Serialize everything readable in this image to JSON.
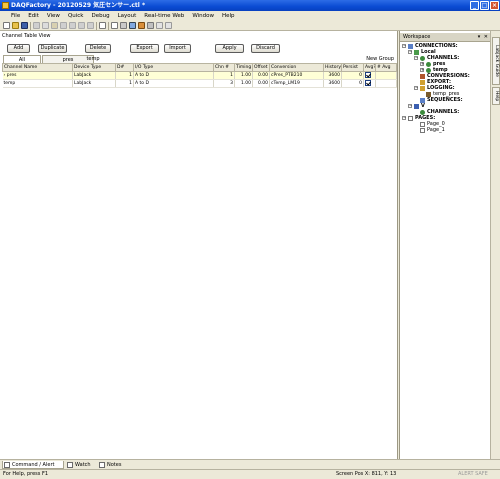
{
  "window": {
    "title": "DAQFactory - 20120529 気圧センサー.ctl *"
  },
  "menu": [
    "File",
    "Edit",
    "View",
    "Quick",
    "Debug",
    "Layout",
    "Real-time Web",
    "Window",
    "Help"
  ],
  "panel": {
    "title": "Channel Table View",
    "buttons": {
      "add": "Add",
      "duplicate": "Duplicate",
      "delete": "Delete",
      "export": "Export",
      "import": "Import",
      "apply": "Apply",
      "discard": "Discard"
    },
    "tabs": {
      "all": "All",
      "pres": "pres",
      "temp": "temp"
    },
    "new_group": "New Group"
  },
  "table": {
    "columns": {
      "name": "Channel Name",
      "device": "Device Type",
      "d_num": "D#",
      "io": "I/O Type",
      "chn": "Chn #",
      "timing": "Timing",
      "offset": "Offset",
      "conversion": "Conversion",
      "history": "History",
      "persist": "Persist",
      "avg": "Avg?",
      "num_avg": "# Avg"
    },
    "rows": [
      {
        "marker": "›",
        "name": "pres",
        "device": "LabJack",
        "d_num": "1",
        "io": "A to D",
        "chn": "1",
        "timing": "1.00",
        "offset": "0.00",
        "conversion": "cPres_PTB210",
        "history": "3600",
        "persist": "0",
        "avg": "",
        "num_avg": ""
      },
      {
        "marker": "",
        "name": "temp",
        "device": "LabJack",
        "d_num": "1",
        "io": "A to D",
        "chn": "3",
        "timing": "1.00",
        "offset": "0.00",
        "conversion": "cTemp_LM19",
        "history": "3600",
        "persist": "0",
        "avg": "",
        "num_avg": ""
      }
    ]
  },
  "workspace": {
    "title": "Workspace",
    "title_buttons": "▾ ✕",
    "tree": {
      "connections": "CONNECTIONS:",
      "local": "Local",
      "channels": "CHANNELS:",
      "pres": "pres",
      "temp": "temp",
      "conversions": "CONVERSIONS:",
      "export": "EXPORT:",
      "logging": "LOGGING:",
      "temp_pres": "temp_pres",
      "sequences": "SEQUENCES:",
      "v": "V",
      "v_channels": "CHANNELS:",
      "pages": "PAGES:",
      "page0": "Page_0",
      "page1": "Page_1"
    }
  },
  "side_tabs": {
    "guide": "LabJack Guide",
    "help": "Help"
  },
  "bottom_tabs": {
    "command": "Command / Alert",
    "watch": "Watch",
    "notes": "Notes"
  },
  "status": {
    "help": "For Help, press F1",
    "pos": "Screen Pos X: 811, Y: 13",
    "alert": "ALERT SAFE"
  },
  "colors": {
    "title_bar": "#0a4bd3",
    "selected_row": "#ffffd6",
    "workspace_bg": "#ffffff"
  }
}
